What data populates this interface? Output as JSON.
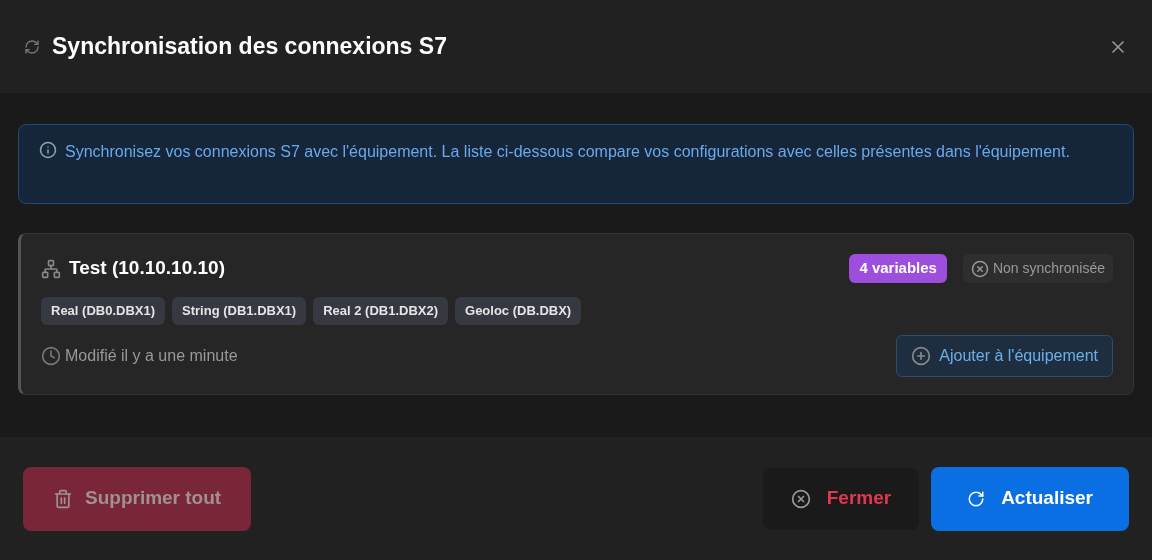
{
  "dialog": {
    "title": "Synchronisation des connexions S7"
  },
  "info": {
    "text": "Synchronisez vos connexions S7 avec l'équipement. La liste ci-dessous compare vos configurations avec celles présentes dans l'équipement."
  },
  "connections": [
    {
      "name": "Test (10.10.10.10)",
      "count_badge": "4 variables",
      "synced": false,
      "status": "Non synchronisée",
      "variables": [
        "Real (DB0.DBX1)",
        "String (DB1.DBX1)",
        "Real 2 (DB1.DBX2)",
        "Geoloc (DB.DBX)"
      ],
      "modified": "Modifié il y a une minute",
      "action": "Ajouter à l'équipement"
    }
  ],
  "footer": {
    "delete_all": {
      "label": "Supprimer tout",
      "disabled": true
    },
    "close": {
      "label": "Fermer"
    },
    "refresh": {
      "label": "Actualiser"
    }
  }
}
